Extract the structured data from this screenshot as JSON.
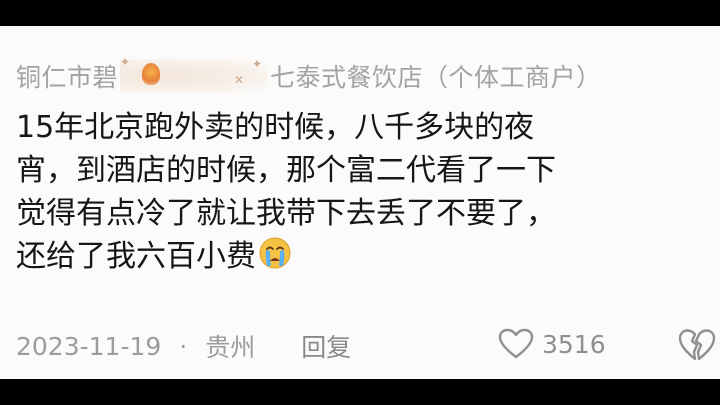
{
  "comment": {
    "author_prefix": "铜仁市碧",
    "author_suffix": "七泰式餐饮店（个体工商户）",
    "lines": [
      "15年北京跑外卖的时候，八千多块的夜",
      "宵，到酒店的时候，那个富二代看了一下",
      "觉得有点冷了就让我带下去丢了不要了，",
      "还给了我六百小费"
    ],
    "emoji": "crying-face-icon",
    "date": "2023-11-19",
    "separator": "·",
    "location": "贵州",
    "reply_label": "回复",
    "like_count": "3516"
  },
  "colors": {
    "background": "#fbfbfb",
    "text": "#161616",
    "meta_text": "#9c9c9c",
    "frame": "#000000"
  }
}
